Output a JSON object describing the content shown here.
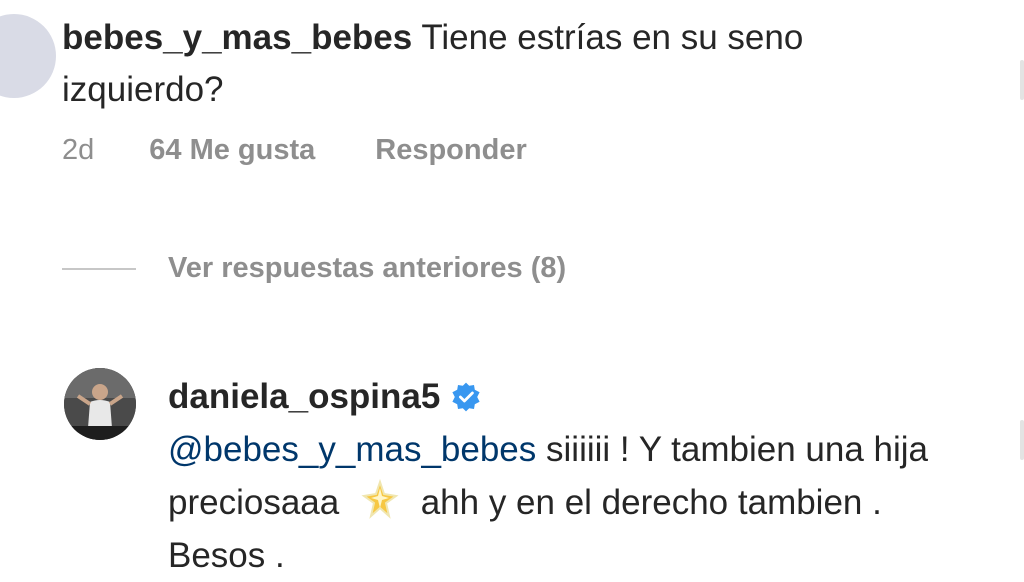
{
  "comment1": {
    "username": "bebes_y_mas_bebes",
    "text": "Tiene estrías en su seno izquierdo?",
    "time": "2d",
    "likes": "64 Me gusta",
    "reply_label": "Responder"
  },
  "view_previous": {
    "label": "Ver respuestas anteriores (8)"
  },
  "comment2": {
    "username": "daniela_ospina5",
    "verified": true,
    "mention": "@bebes_y_mas_bebes",
    "text_part1": "siiiiii ! Y tambien una hija preciosaaa",
    "emoji_icon": "sparkle-star-icon",
    "text_part2": "ahh y en el derecho tambien . Besos ."
  },
  "colors": {
    "text": "#262626",
    "meta": "#8e8e8e",
    "mention": "#00376b",
    "verified": "#3897f0"
  }
}
